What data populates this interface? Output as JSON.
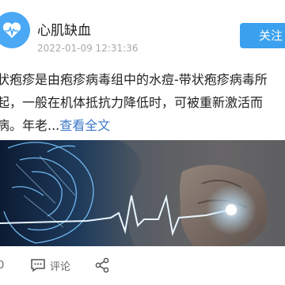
{
  "author": {
    "name": "心肌缺血"
  },
  "post": {
    "timestamp": "2022-01-09 12:31:36",
    "lines": [
      "状疱疹是由疱疹病毒组中的水痘-带状疱疹病毒所",
      "起，一般在机体抵抗力降低时，可被重新激活而",
      "病。年老..."
    ],
    "more_label": "查看全文"
  },
  "header": {
    "follow_label": "关注"
  },
  "footer": {
    "like_count": "0",
    "comment_label": "评论"
  },
  "colors": {
    "accent": "#3ba1ee",
    "link": "#3b78c8"
  },
  "icons": [
    "avatar-heart-icon",
    "like-icon",
    "comment-icon",
    "share-icon"
  ]
}
